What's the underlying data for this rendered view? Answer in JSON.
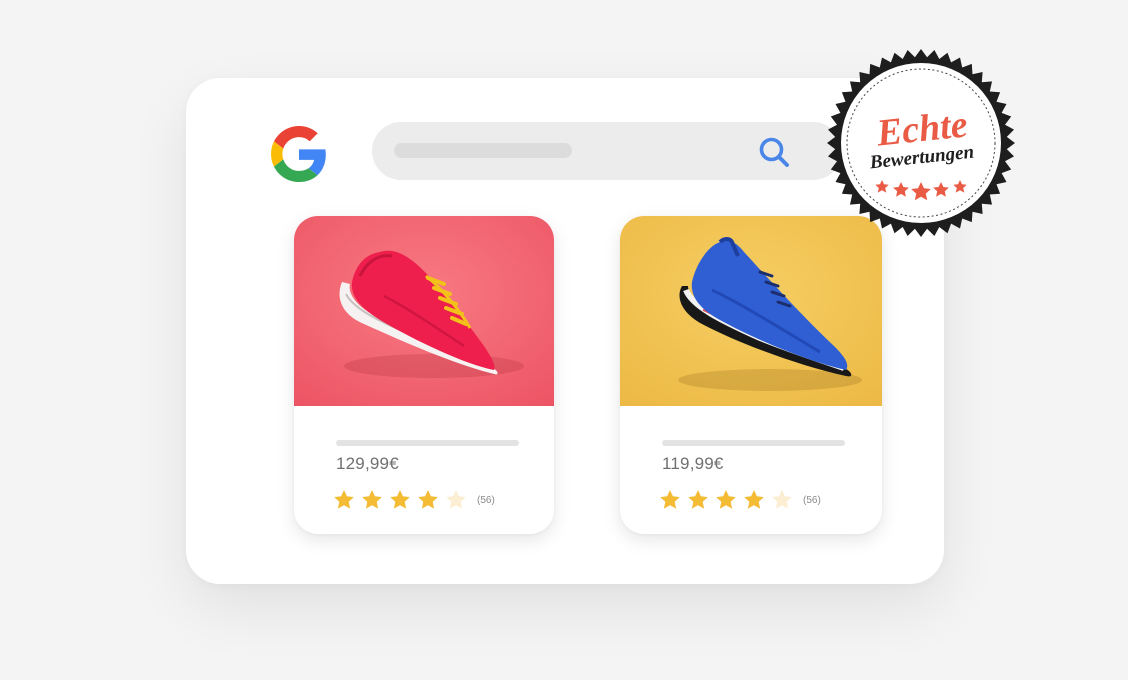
{
  "branding": {
    "search_engine_logo": "google-g-icon"
  },
  "search": {
    "icon": "search-icon",
    "accent_color": "#4a86e8"
  },
  "badge": {
    "title": "Echte",
    "subtitle": "Bewertungen",
    "stars": 5,
    "colors": {
      "ring": "#1e1e1e",
      "accent": "#e95b45"
    }
  },
  "products": [
    {
      "image": "red-running-shoe",
      "image_background": "#f0606e",
      "price": "129,99€",
      "rating": 4,
      "rating_max": 5,
      "review_count": "(56)"
    },
    {
      "image": "blue-running-shoe",
      "image_background": "#f0c04e",
      "price": "119,99€",
      "rating": 4,
      "rating_max": 5,
      "review_count": "(56)"
    }
  ],
  "colors": {
    "star_filled": "#f4bb35",
    "star_empty": "#fbeed2"
  }
}
